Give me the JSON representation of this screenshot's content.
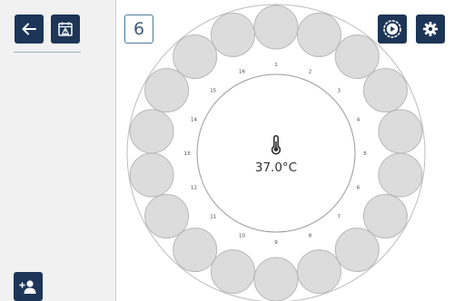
{
  "sidebar": {
    "back_icon": "arrow-left-icon",
    "alarm_icon": "calendar-warning-icon",
    "add_user_icon": "add-user-icon"
  },
  "toolbar": {
    "slot_count": "6",
    "play_icon": "play-circle-icon",
    "settings_icon": "gear-icon"
  },
  "carousel": {
    "temperature": "37.0°C",
    "thermometer_icon": "thermometer-icon",
    "positions": [
      "1",
      "2",
      "3",
      "4",
      "5",
      "6",
      "7",
      "8",
      "9",
      "10",
      "11",
      "12",
      "13",
      "14",
      "15",
      "16"
    ]
  },
  "colors": {
    "accent": "#1d3557",
    "slot_fill": "#dcdcdc",
    "slot_stroke": "#b8b8b8"
  }
}
